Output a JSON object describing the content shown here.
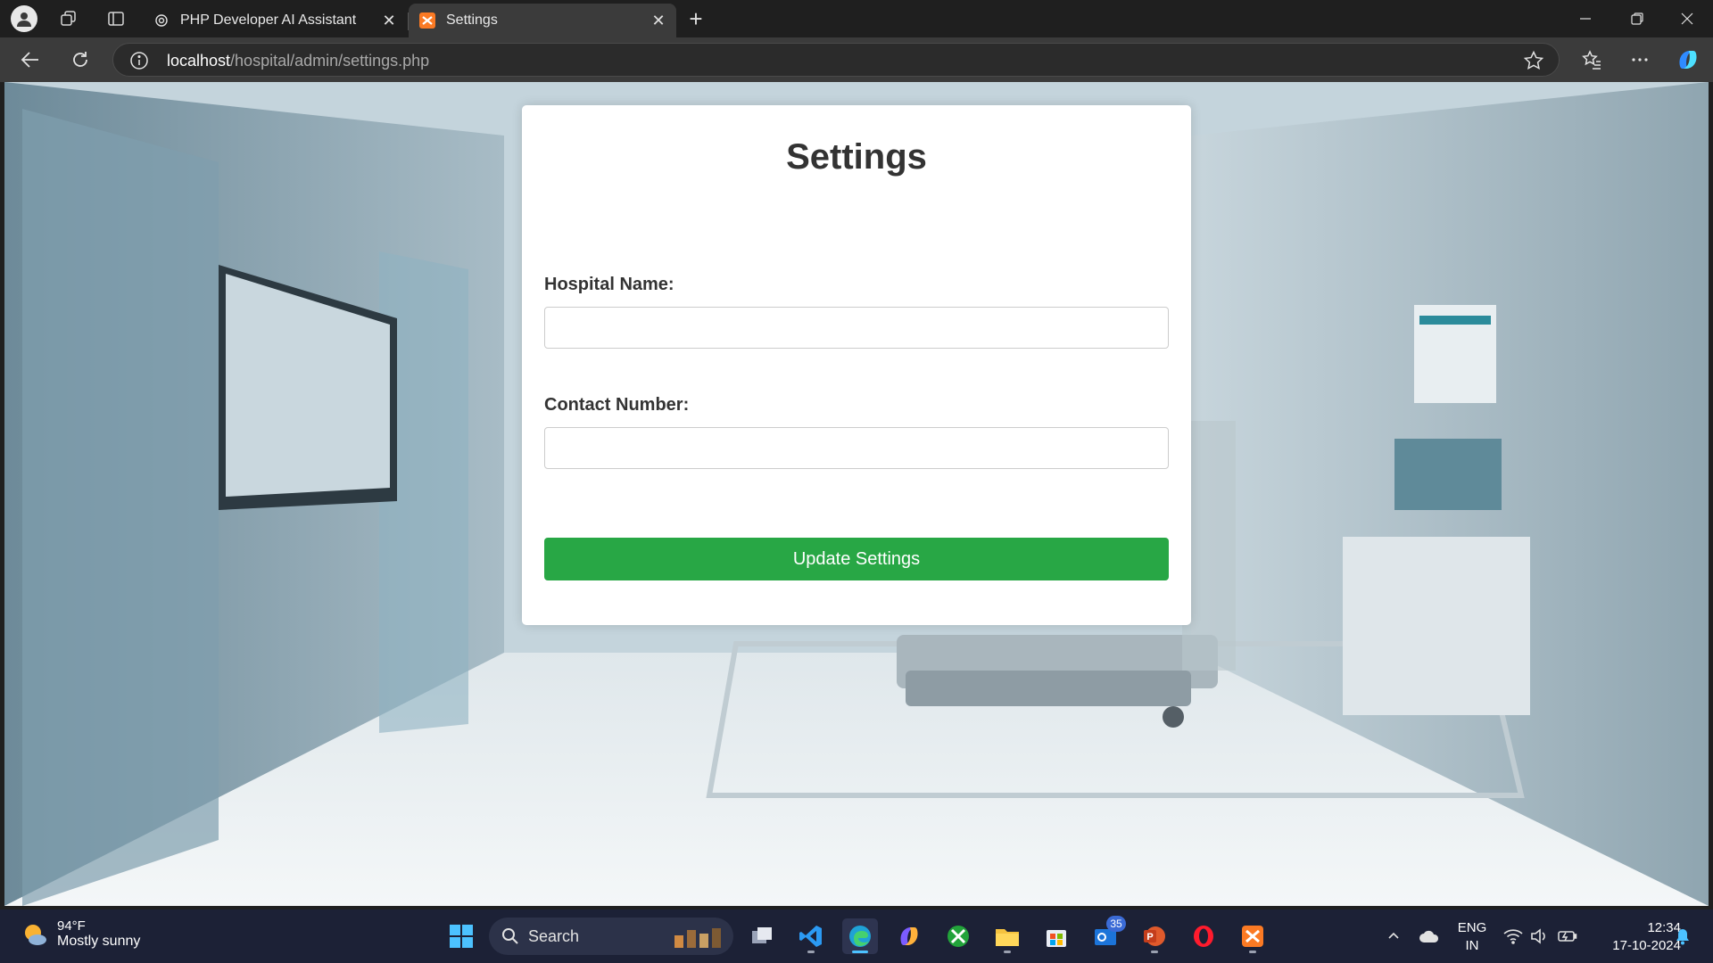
{
  "browser": {
    "tabs": [
      {
        "title": "PHP Developer AI Assistant",
        "active": false
      },
      {
        "title": "Settings",
        "active": true
      }
    ],
    "url_host": "localhost",
    "url_path": "/hospital/admin/settings.php"
  },
  "page": {
    "heading": "Settings",
    "fields": [
      {
        "label": "Hospital Name:",
        "value": ""
      },
      {
        "label": "Contact Number:",
        "value": ""
      }
    ],
    "submit_label": "Update Settings"
  },
  "taskbar": {
    "weather_temp": "94°F",
    "weather_desc": "Mostly sunny",
    "search_label": "Search",
    "mail_badge": "35",
    "lang_line1": "ENG",
    "lang_line2": "IN",
    "time": "12:34",
    "date": "17-10-2024"
  },
  "colors": {
    "accent_button": "#28a745",
    "taskbar": "#1c2136",
    "browser_chrome": "#1f1f1f"
  }
}
